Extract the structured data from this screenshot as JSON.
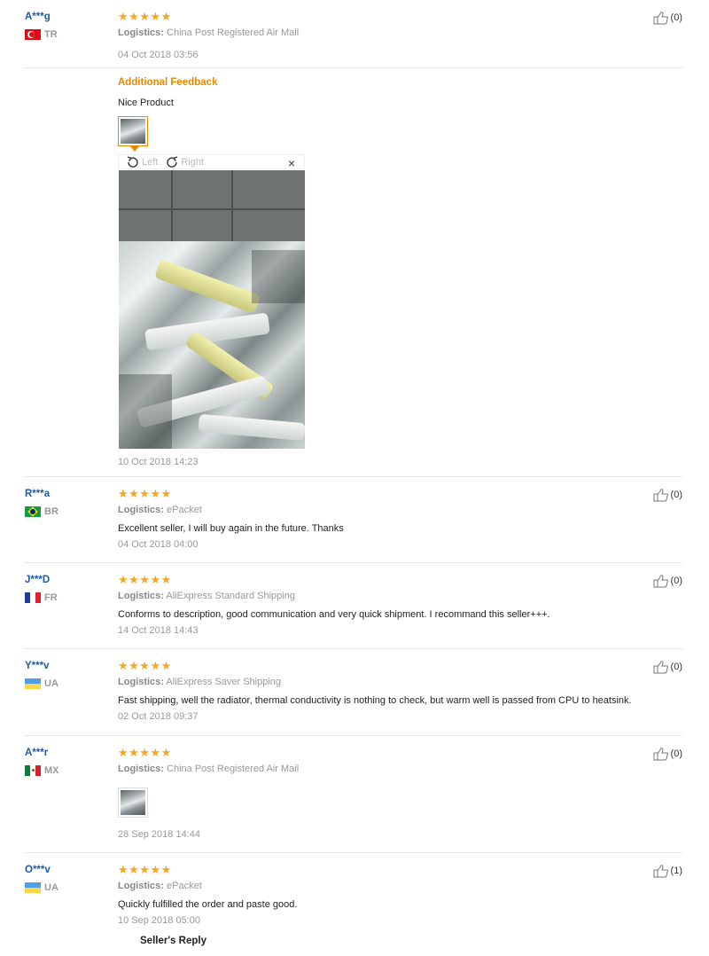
{
  "reviews": [
    {
      "user": "A***g",
      "country": "TR",
      "flag_icon": "flag-tr-icon",
      "logistics_label": "Logistics:",
      "logistics": "China Post Registered Air Mail",
      "date": "04 Oct 2018 03:56",
      "helpful": "(0)",
      "additional_feedback": {
        "title": "Additional Feedback",
        "text": "Nice Product",
        "date": "10 Oct 2018 14:23"
      }
    },
    {
      "user": "R***a",
      "country": "BR",
      "flag_icon": "flag-br-icon",
      "logistics_label": "Logistics:",
      "logistics": "ePacket",
      "text": "Excellent seller, I will buy again in the future. Thanks",
      "date": "04 Oct 2018 04:00",
      "helpful": "(0)"
    },
    {
      "user": "J***D",
      "country": "FR",
      "flag_icon": "flag-fr-icon",
      "logistics_label": "Logistics:",
      "logistics": "AliExpress Standard Shipping",
      "text": "Conforms to description, good communication and very quick shipment. I recommand this seller+++.",
      "date": "14 Oct 2018 14:43",
      "helpful": "(0)"
    },
    {
      "user": "Y***v",
      "country": "UA",
      "flag_icon": "flag-ua-icon",
      "logistics_label": "Logistics:",
      "logistics": "AliExpress Saver Shipping",
      "text": "Fast shipping, well the radiator, thermal conductivity is nothing to check, but warm well is passed from CPU to heatsink.",
      "date": "02 Oct 2018 09:37",
      "helpful": "(0)"
    },
    {
      "user": "A***r",
      "country": "MX",
      "flag_icon": "flag-mx-icon",
      "logistics_label": "Logistics:",
      "logistics": "China Post Registered Air Mail",
      "date": "28 Sep 2018 14:44",
      "helpful": "(0)"
    },
    {
      "user": "O***v",
      "country": "UA",
      "flag_icon": "flag-ua-icon",
      "logistics_label": "Logistics:",
      "logistics": "ePacket",
      "text": "Quickly fulfilled the order and paste good.",
      "date": "10 Sep 2018 05:00",
      "helpful": "(1)",
      "seller_reply": "Seller's Reply"
    }
  ],
  "stars": "★★★★★",
  "viewer": {
    "left_label": "Left",
    "right_label": "Right",
    "close_label": "×"
  },
  "colors": {
    "star": "#f6a623",
    "username": "#1a5ba8",
    "additional_feedback": "#e58a00"
  }
}
